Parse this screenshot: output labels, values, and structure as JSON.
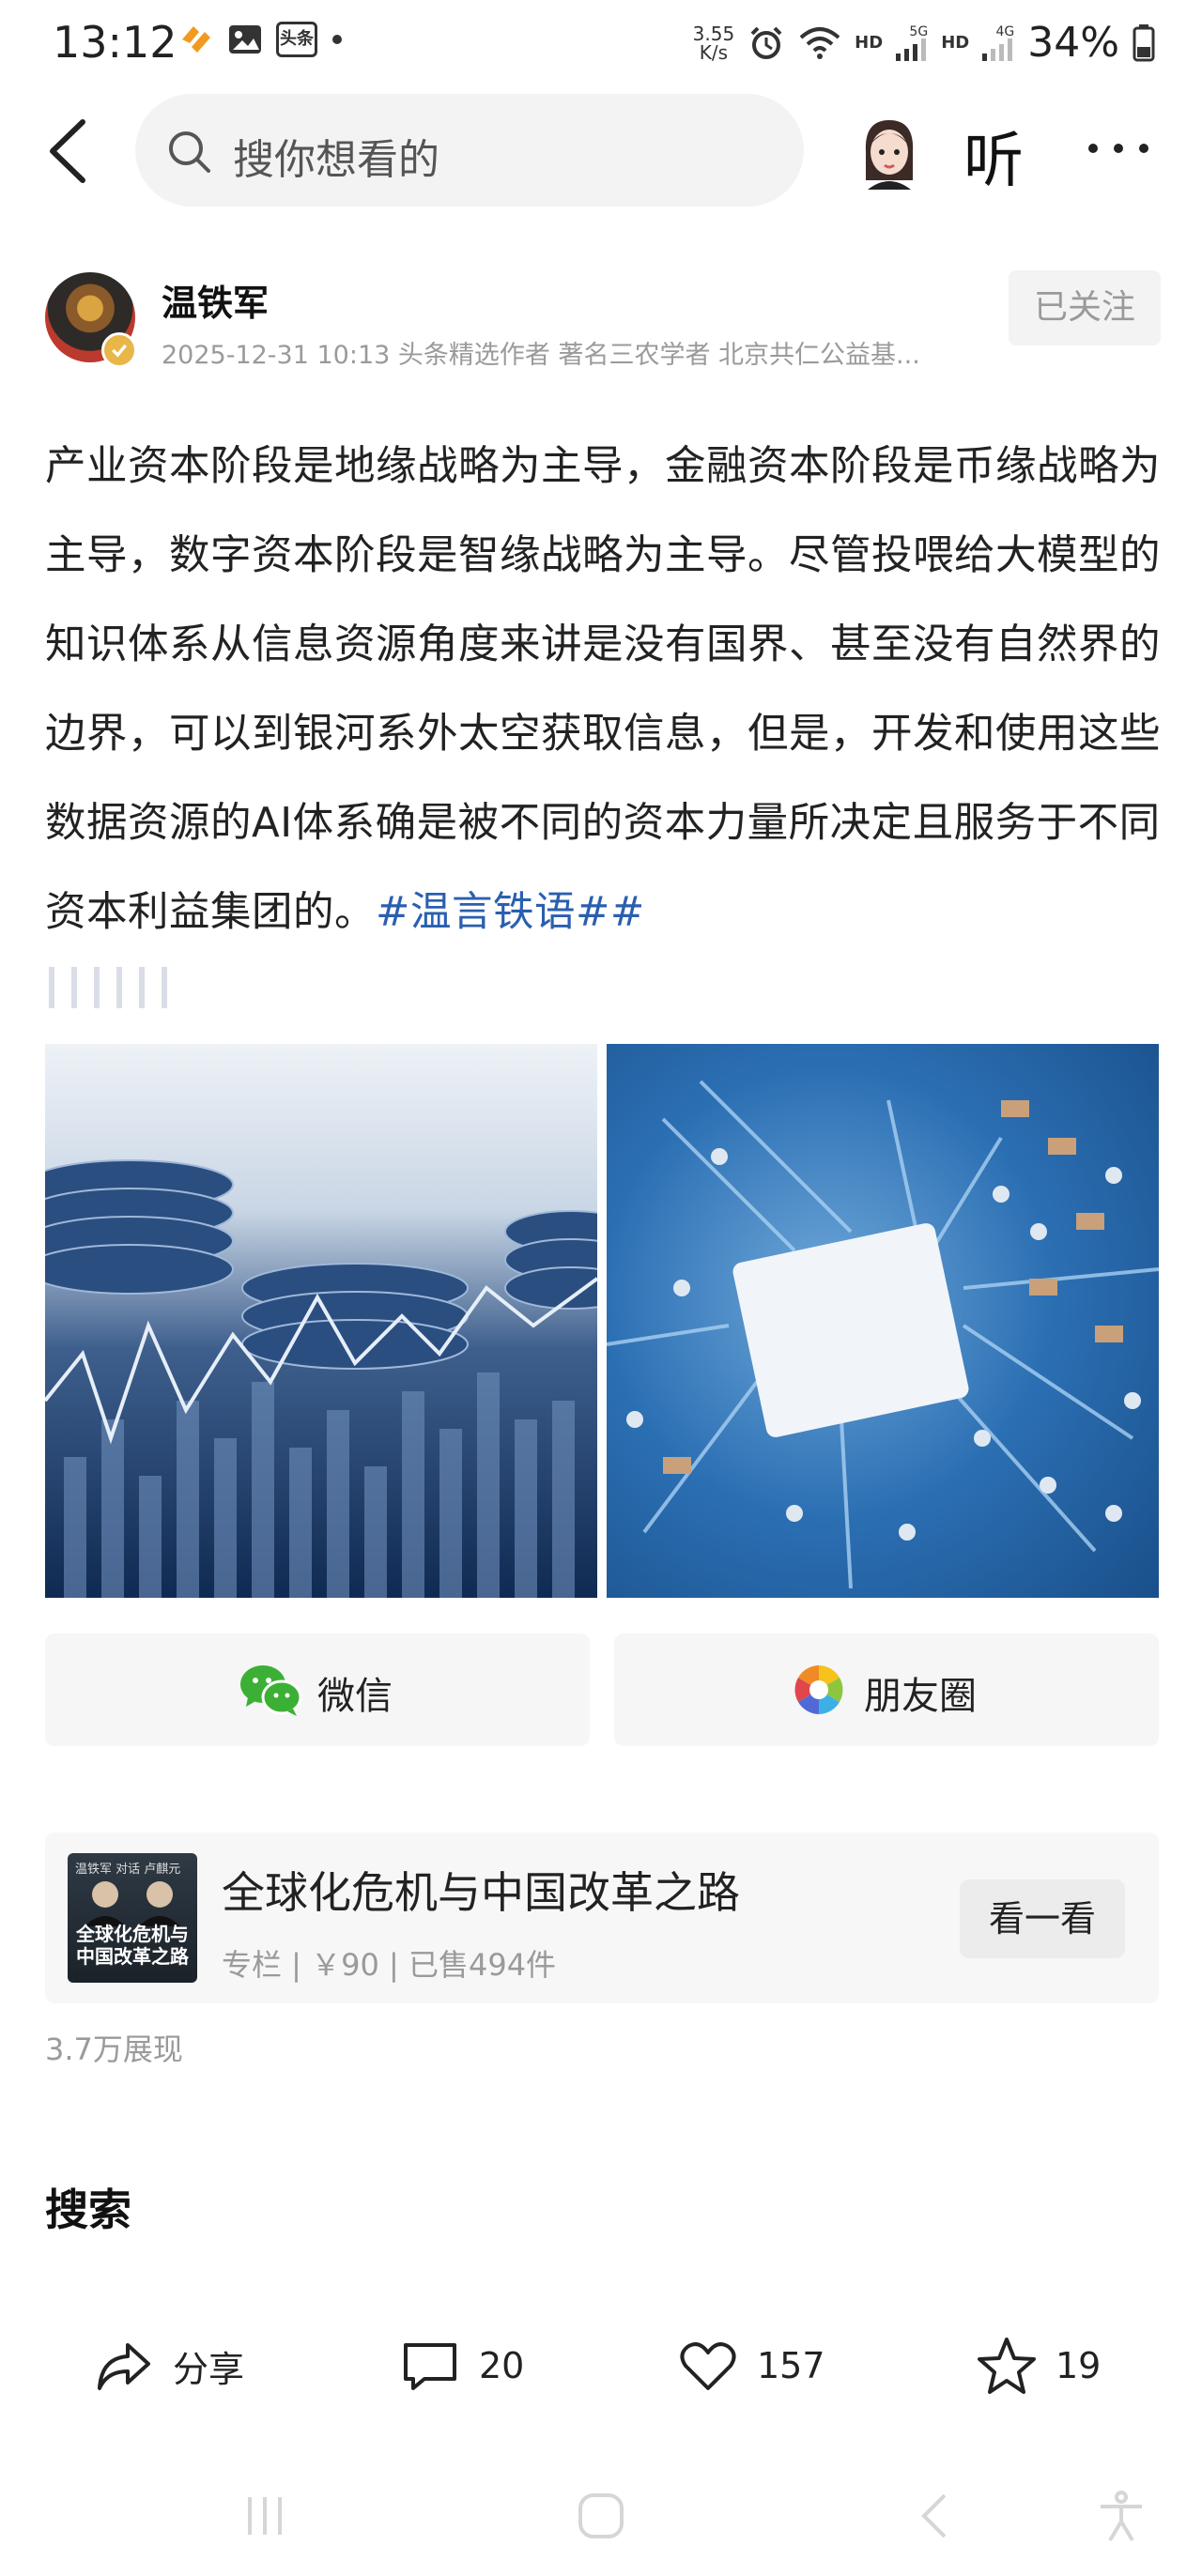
{
  "status_bar": {
    "time": "13:12",
    "net_speed": "3.55\nK/s",
    "battery": "34%",
    "left_badge": "头条",
    "hd1": "HD",
    "hd2": "HD",
    "sig1": "5G",
    "sig2": "4G"
  },
  "nav": {
    "search_placeholder": "搜你想看的",
    "listen_label": "听"
  },
  "author": {
    "name": "温铁军",
    "meta": "2025-12-31 10:13 头条精选作者 著名三农学者 北京共仁公益基...",
    "follow_label": "已关注"
  },
  "article": {
    "body": "产业资本阶段是地缘战略为主导，金融资本阶段是币缘战略为主导，数字资本阶段是智缘战略为主导。尽管投喂给大模型的知识体系从信息资源角度来讲是没有国界、甚至没有自然界的边界，可以到银河系外太空获取信息，但是，开发和使用这些数据资源的AI体系确是被不同的资本力量所决定且服务于不同资本利益集团的。",
    "hashtag": "#温言铁语##"
  },
  "share": {
    "wechat_label": "微信",
    "moments_label": "朋友圈"
  },
  "column": {
    "cover_top": "温铁军 对话 卢麒元",
    "cover_title": "全球化危机与中国改革之路",
    "title": "全球化危机与中国改革之路",
    "meta": "专栏 | ￥90 | 已售494件",
    "view_label": "看一看"
  },
  "impressions": "3.7万展现",
  "search_heading": "搜索",
  "actions": {
    "share_label": "分享",
    "comments": "20",
    "likes": "157",
    "favorites": "19"
  },
  "colors": {
    "hashtag": "#2a5fb0",
    "muted": "#9a9a9a",
    "wechat_green": "#3cb034"
  }
}
